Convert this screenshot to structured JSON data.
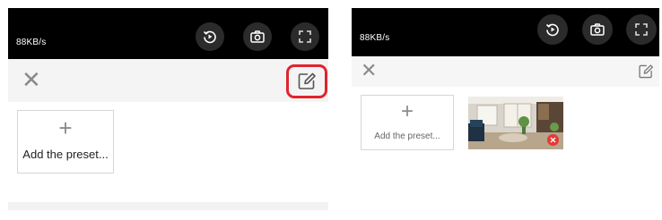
{
  "screens": [
    {
      "video": {
        "data_rate": "88KB/s"
      },
      "toolbar": {
        "close_icon": "close-icon",
        "edit_icon": "edit-icon",
        "edit_highlight_color": "#e0242d"
      },
      "preset_add": {
        "icon": "plus-icon",
        "label": "Add the preset..."
      }
    },
    {
      "video": {
        "data_rate": "88KB/s"
      },
      "toolbar": {
        "close_icon": "close-icon",
        "edit_icon": "edit-icon"
      },
      "preset_add": {
        "icon": "plus-icon",
        "label": "Add the preset..."
      },
      "presets": [
        {
          "kind": "thumbnail",
          "icon": "delete-badge-icon",
          "badge_color": "#e53935"
        }
      ]
    }
  ],
  "colors": {
    "video_bg": "#000000",
    "toolbar_bg": "#f4f4f4",
    "accent_red": "#e0242d"
  }
}
